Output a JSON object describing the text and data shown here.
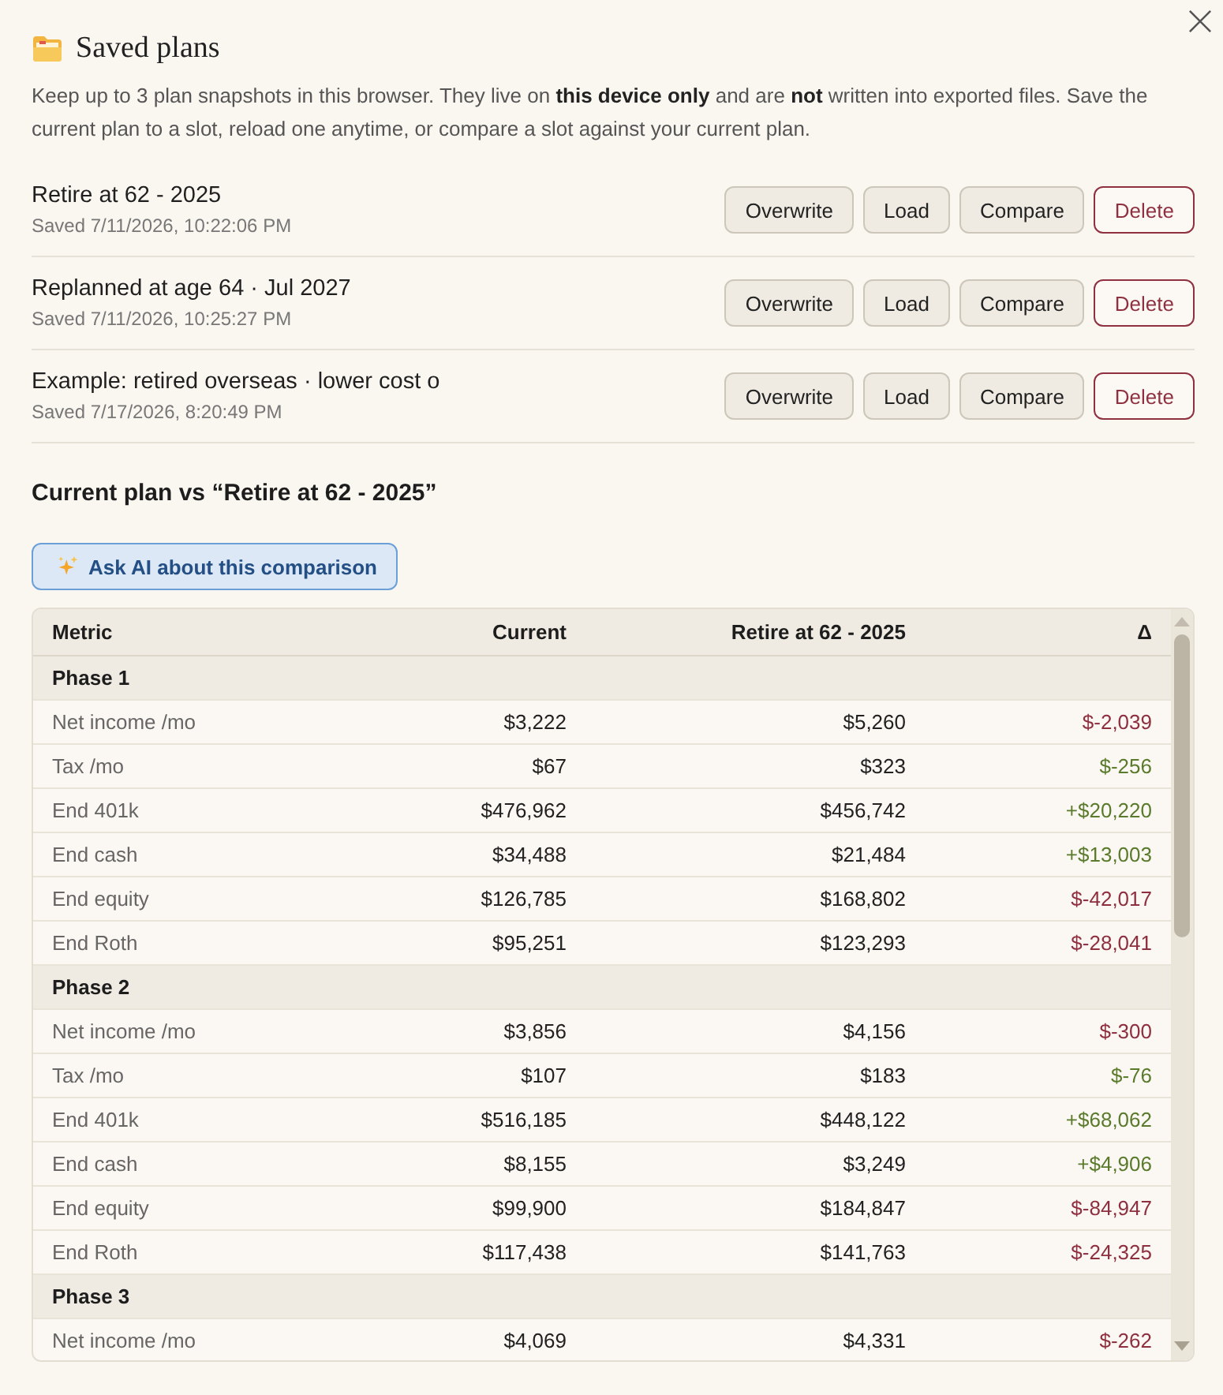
{
  "dialog": {
    "title": "Saved plans",
    "description": "Keep up to 3 plan snapshots in this browser. They live on **this device only** and are **not** written into exported files. Save the current plan to a slot, reload one anytime, or compare a slot against your current plan."
  },
  "plans": [
    {
      "name": "Retire at 62 - 2025",
      "saved": "Saved 7/11/2026, 10:22:06 PM",
      "actions": [
        {
          "label": "Overwrite",
          "kind": "neutral"
        },
        {
          "label": "Load",
          "kind": "neutral"
        },
        {
          "label": "Compare",
          "kind": "neutral"
        },
        {
          "label": "Delete",
          "kind": "danger"
        }
      ]
    },
    {
      "name": "Replanned at age 64 · Jul 2027",
      "saved": "Saved 7/11/2026, 10:25:27 PM",
      "actions": [
        {
          "label": "Overwrite",
          "kind": "neutral"
        },
        {
          "label": "Load",
          "kind": "neutral"
        },
        {
          "label": "Compare",
          "kind": "neutral"
        },
        {
          "label": "Delete",
          "kind": "danger"
        }
      ]
    },
    {
      "name": "Example: retired overseas · lower cost o",
      "saved": "Saved 7/17/2026, 8:20:49 PM",
      "actions": [
        {
          "label": "Overwrite",
          "kind": "neutral"
        },
        {
          "label": "Load",
          "kind": "neutral"
        },
        {
          "label": "Compare",
          "kind": "neutral"
        },
        {
          "label": "Delete",
          "kind": "danger"
        }
      ]
    }
  ],
  "comparison": {
    "heading": "Current plan vs “Retire at 62 - 2025”",
    "ask_button": "Ask AI about this comparison",
    "table": {
      "columns": [
        "Metric",
        "Current",
        "Retire at 62 - 2025",
        "Δ"
      ],
      "rows": [
        {
          "kind": "phase",
          "label": "Phase 1"
        },
        {
          "kind": "metric",
          "label": "Net income /mo",
          "current": "$3,222",
          "saved": "$5,260",
          "delta": "$-2,039",
          "favorable": false
        },
        {
          "kind": "metric",
          "label": "Tax /mo",
          "current": "$67",
          "saved": "$323",
          "delta": "$-256",
          "favorable": true
        },
        {
          "kind": "metric",
          "label": "End 401k",
          "current": "$476,962",
          "saved": "$456,742",
          "delta": "+$20,220",
          "favorable": true
        },
        {
          "kind": "metric",
          "label": "End cash",
          "current": "$34,488",
          "saved": "$21,484",
          "delta": "+$13,003",
          "favorable": true
        },
        {
          "kind": "metric",
          "label": "End equity",
          "current": "$126,785",
          "saved": "$168,802",
          "delta": "$-42,017",
          "favorable": false
        },
        {
          "kind": "metric",
          "label": "End Roth",
          "current": "$95,251",
          "saved": "$123,293",
          "delta": "$-28,041",
          "favorable": false
        },
        {
          "kind": "phase",
          "label": "Phase 2"
        },
        {
          "kind": "metric",
          "label": "Net income /mo",
          "current": "$3,856",
          "saved": "$4,156",
          "delta": "$-300",
          "favorable": false
        },
        {
          "kind": "metric",
          "label": "Tax /mo",
          "current": "$107",
          "saved": "$183",
          "delta": "$-76",
          "favorable": true
        },
        {
          "kind": "metric",
          "label": "End 401k",
          "current": "$516,185",
          "saved": "$448,122",
          "delta": "+$68,062",
          "favorable": true
        },
        {
          "kind": "metric",
          "label": "End cash",
          "current": "$8,155",
          "saved": "$3,249",
          "delta": "+$4,906",
          "favorable": true
        },
        {
          "kind": "metric",
          "label": "End equity",
          "current": "$99,900",
          "saved": "$184,847",
          "delta": "$-84,947",
          "favorable": false
        },
        {
          "kind": "metric",
          "label": "End Roth",
          "current": "$117,438",
          "saved": "$141,763",
          "delta": "$-24,325",
          "favorable": false
        },
        {
          "kind": "phase",
          "label": "Phase 3"
        },
        {
          "kind": "metric",
          "label": "Net income /mo",
          "current": "$4,069",
          "saved": "$4,331",
          "delta": "$-262",
          "favorable": false
        }
      ]
    }
  }
}
